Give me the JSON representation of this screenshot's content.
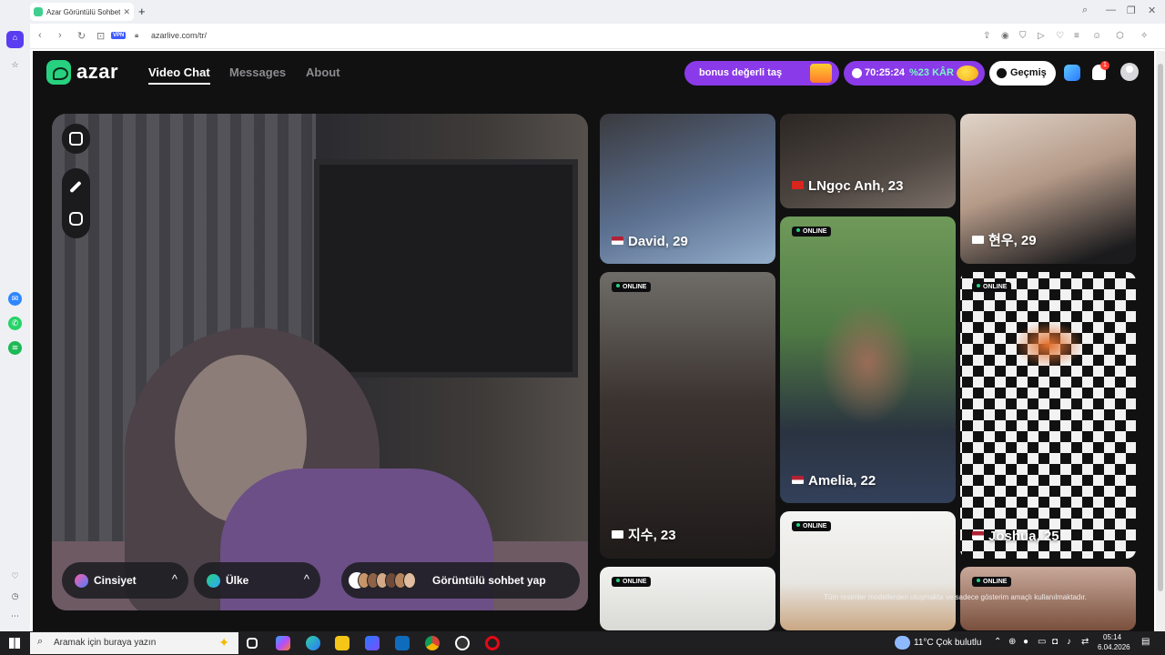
{
  "browser": {
    "tab_title": "Azar Görüntülü Sohbet &",
    "new_tab_symbol": "+",
    "vpn_label": "VPN",
    "url": "azarlive.com/tr/"
  },
  "app": {
    "logo_text": "azar",
    "nav": [
      "Video Chat",
      "Messages",
      "About"
    ],
    "promo_text": "bonus değerli taş",
    "countdown": "70:25:24",
    "discount": "%23 KÂR",
    "history_label": "Geçmiş",
    "notification_count": "1"
  },
  "filters": {
    "gender_label": "Cinsiyet",
    "country_label": "Ülke",
    "start_label": "Görüntülü sohbet yap",
    "chevron": "^"
  },
  "cards": [
    {
      "name": "David, 29",
      "online": ""
    },
    {
      "name": "LNgọc Anh, 23",
      "online": ""
    },
    {
      "name": "현우, 29",
      "online": ""
    },
    {
      "name": "지수, 23",
      "online": "ONLINE"
    },
    {
      "name": "Amelia, 22",
      "online": "ONLINE"
    },
    {
      "name": "Joshua, 25",
      "online": "ONLINE"
    },
    {
      "name": "",
      "online": "ONLINE"
    },
    {
      "name": "",
      "online": "ONLINE"
    },
    {
      "name": "",
      "online": "ONLINE"
    }
  ],
  "disclaimer": "Tüm resimler modellerden oluşmakta ve sadece gösterim amaçlı kullanılmaktadır.",
  "taskbar": {
    "search_placeholder": "Aramak için buraya yazın",
    "weather": "11°C  Çok bulutlu",
    "time": "05:14",
    "date": "6.04.2026"
  },
  "colors": {
    "accent_green": "#27d17f",
    "promo_purple": "#8a3ae8",
    "app_bg": "#111112"
  }
}
